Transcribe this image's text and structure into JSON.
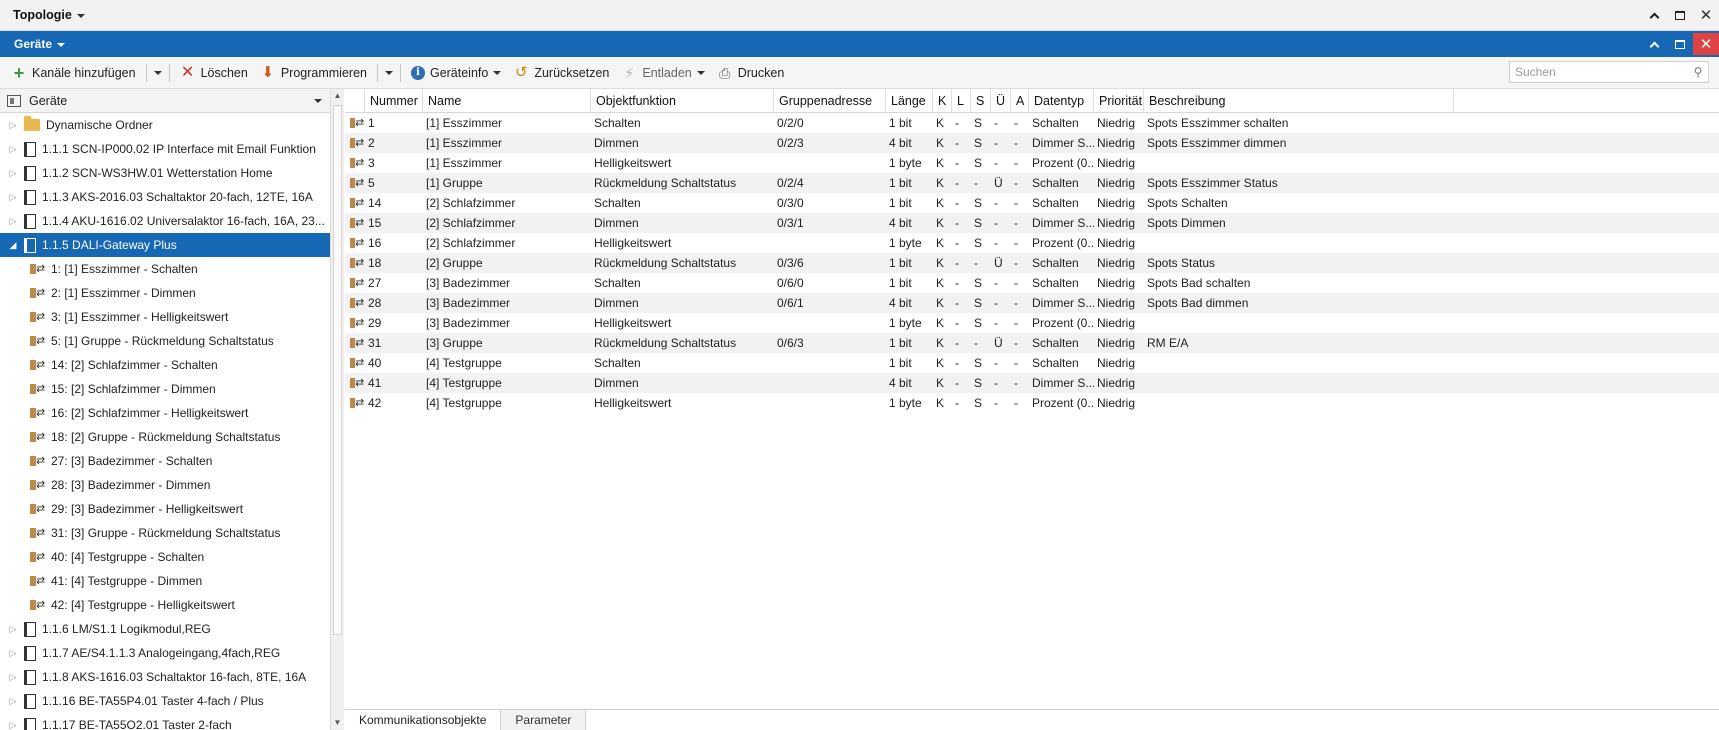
{
  "topology": {
    "title": "Topologie"
  },
  "devices_panel": {
    "title": "Geräte"
  },
  "toolbar": {
    "add_channels": "Kanäle hinzufügen",
    "delete": "Löschen",
    "program": "Programmieren",
    "device_info": "Geräteinfo",
    "reset": "Zurücksetzen",
    "unload": "Entladen",
    "print": "Drucken",
    "search_placeholder": "Suchen"
  },
  "tree": {
    "header": "Geräte",
    "items": [
      {
        "label": "Dynamische Ordner",
        "kind": "folder"
      },
      {
        "label": "1.1.1 SCN-IP000.02 IP Interface mit Email Funktion",
        "kind": "device"
      },
      {
        "label": "1.1.2 SCN-WS3HW.01 Wetterstation Home",
        "kind": "device"
      },
      {
        "label": "1.1.3 AKS-2016.03 Schaltaktor 20-fach, 12TE, 16A",
        "kind": "device"
      },
      {
        "label": "1.1.4 AKU-1616.02 Universalaktor 16-fach, 16A, 23...",
        "kind": "device"
      },
      {
        "label": "1.1.5 DALI-Gateway Plus",
        "kind": "device",
        "selected": true,
        "expanded": true
      },
      {
        "label": "1: [1] Esszimmer - Schalten",
        "kind": "object"
      },
      {
        "label": "2: [1] Esszimmer - Dimmen",
        "kind": "object"
      },
      {
        "label": "3: [1] Esszimmer - Helligkeitswert",
        "kind": "object"
      },
      {
        "label": "5: [1] Gruppe - Rückmeldung Schaltstatus",
        "kind": "object"
      },
      {
        "label": "14: [2] Schlafzimmer - Schalten",
        "kind": "object"
      },
      {
        "label": "15: [2] Schlafzimmer - Dimmen",
        "kind": "object"
      },
      {
        "label": "16: [2] Schlafzimmer - Helligkeitswert",
        "kind": "object"
      },
      {
        "label": "18: [2] Gruppe - Rückmeldung Schaltstatus",
        "kind": "object"
      },
      {
        "label": "27: [3] Badezimmer - Schalten",
        "kind": "object"
      },
      {
        "label": "28: [3] Badezimmer - Dimmen",
        "kind": "object"
      },
      {
        "label": "29: [3] Badezimmer - Helligkeitswert",
        "kind": "object"
      },
      {
        "label": "31: [3] Gruppe - Rückmeldung Schaltstatus",
        "kind": "object"
      },
      {
        "label": "40: [4] Testgruppe - Schalten",
        "kind": "object"
      },
      {
        "label": "41: [4] Testgruppe - Dimmen",
        "kind": "object"
      },
      {
        "label": "42: [4] Testgruppe - Helligkeitswert",
        "kind": "object"
      },
      {
        "label": "1.1.6 LM/S1.1 Logikmodul,REG",
        "kind": "device"
      },
      {
        "label": "1.1.7 AE/S4.1.1.3 Analogeingang,4fach,REG",
        "kind": "device"
      },
      {
        "label": "1.1.8 AKS-1616.03 Schaltaktor 16-fach, 8TE, 16A",
        "kind": "device"
      },
      {
        "label": "1.1.16 BE-TA55P4.01 Taster 4-fach / Plus",
        "kind": "device"
      },
      {
        "label": "1.1.17 BE-TA55O2.01 Taster 2-fach",
        "kind": "device"
      }
    ]
  },
  "grid": {
    "columns": [
      "Nummer",
      "Name",
      "Objektfunktion",
      "Gruppenadresse",
      "Länge",
      "K",
      "L",
      "S",
      "Ü",
      "A",
      "Datentyp",
      "Priorität",
      "Beschreibung"
    ],
    "rows": [
      [
        "1",
        "[1] Esszimmer",
        "Schalten",
        "0/2/0",
        "1 bit",
        "K",
        "-",
        "S",
        "-",
        "-",
        "Schalten",
        "Niedrig",
        "Spots Esszimmer schalten"
      ],
      [
        "2",
        "[1] Esszimmer",
        "Dimmen",
        "0/2/3",
        "4 bit",
        "K",
        "-",
        "S",
        "-",
        "-",
        "Dimmer S...",
        "Niedrig",
        "Spots Esszimmer dimmen"
      ],
      [
        "3",
        "[1] Esszimmer",
        "Helligkeitswert",
        "",
        "1 byte",
        "K",
        "-",
        "S",
        "-",
        "-",
        "Prozent (0...",
        "Niedrig",
        ""
      ],
      [
        "5",
        "[1] Gruppe",
        "Rückmeldung Schaltstatus",
        "0/2/4",
        "1 bit",
        "K",
        "-",
        "-",
        "Ü",
        "-",
        "Schalten",
        "Niedrig",
        "Spots Esszimmer Status"
      ],
      [
        "14",
        "[2] Schlafzimmer",
        "Schalten",
        "0/3/0",
        "1 bit",
        "K",
        "-",
        "S",
        "-",
        "-",
        "Schalten",
        "Niedrig",
        "Spots Schalten"
      ],
      [
        "15",
        "[2] Schlafzimmer",
        "Dimmen",
        "0/3/1",
        "4 bit",
        "K",
        "-",
        "S",
        "-",
        "-",
        "Dimmer S...",
        "Niedrig",
        "Spots Dimmen"
      ],
      [
        "16",
        "[2] Schlafzimmer",
        "Helligkeitswert",
        "",
        "1 byte",
        "K",
        "-",
        "S",
        "-",
        "-",
        "Prozent (0...",
        "Niedrig",
        ""
      ],
      [
        "18",
        "[2] Gruppe",
        "Rückmeldung Schaltstatus",
        "0/3/6",
        "1 bit",
        "K",
        "-",
        "-",
        "Ü",
        "-",
        "Schalten",
        "Niedrig",
        "Spots Status"
      ],
      [
        "27",
        "[3] Badezimmer",
        "Schalten",
        "0/6/0",
        "1 bit",
        "K",
        "-",
        "S",
        "-",
        "-",
        "Schalten",
        "Niedrig",
        "Spots Bad schalten"
      ],
      [
        "28",
        "[3] Badezimmer",
        "Dimmen",
        "0/6/1",
        "4 bit",
        "K",
        "-",
        "S",
        "-",
        "-",
        "Dimmer S...",
        "Niedrig",
        "Spots Bad dimmen"
      ],
      [
        "29",
        "[3] Badezimmer",
        "Helligkeitswert",
        "",
        "1 byte",
        "K",
        "-",
        "S",
        "-",
        "-",
        "Prozent (0...",
        "Niedrig",
        ""
      ],
      [
        "31",
        "[3] Gruppe",
        "Rückmeldung Schaltstatus",
        "0/6/3",
        "1 bit",
        "K",
        "-",
        "-",
        "Ü",
        "-",
        "Schalten",
        "Niedrig",
        "RM E/A"
      ],
      [
        "40",
        "[4] Testgruppe",
        "Schalten",
        "",
        "1 bit",
        "K",
        "-",
        "S",
        "-",
        "-",
        "Schalten",
        "Niedrig",
        ""
      ],
      [
        "41",
        "[4] Testgruppe",
        "Dimmen",
        "",
        "4 bit",
        "K",
        "-",
        "S",
        "-",
        "-",
        "Dimmer S...",
        "Niedrig",
        ""
      ],
      [
        "42",
        "[4] Testgruppe",
        "Helligkeitswert",
        "",
        "1 byte",
        "K",
        "-",
        "S",
        "-",
        "-",
        "Prozent (0...",
        "Niedrig",
        ""
      ]
    ]
  },
  "tabs": {
    "objects": "Kommunikationsobjekte",
    "parameters": "Parameter"
  },
  "colors": {
    "accent": "#1668b4",
    "close_button": "#e04343"
  }
}
